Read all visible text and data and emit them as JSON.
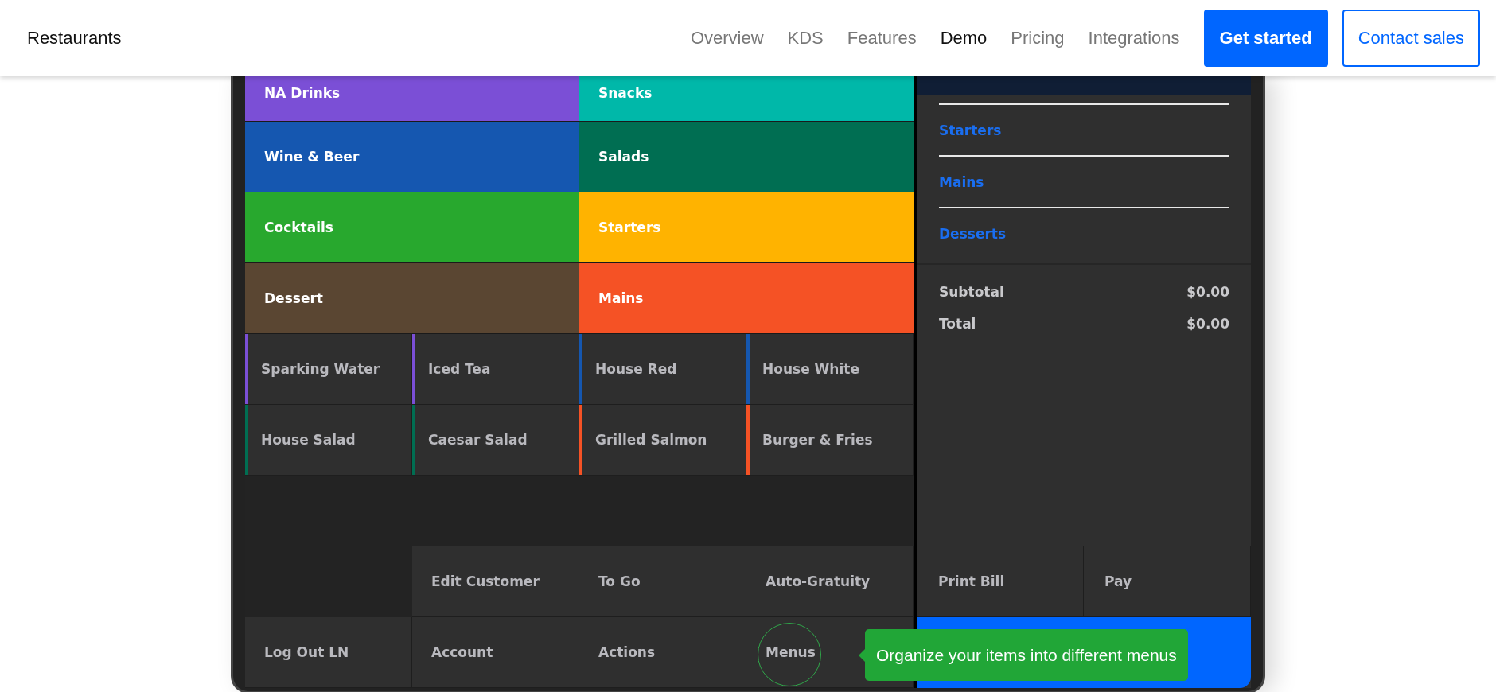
{
  "header": {
    "brand": "Restaurants",
    "nav": [
      {
        "label": "Overview",
        "selected": false
      },
      {
        "label": "KDS",
        "selected": false
      },
      {
        "label": "Features",
        "selected": false
      },
      {
        "label": "Demo",
        "selected": true
      },
      {
        "label": "Pricing",
        "selected": false
      },
      {
        "label": "Integrations",
        "selected": false
      }
    ],
    "buttons": [
      {
        "label": "Get started",
        "kind": "primary"
      },
      {
        "label": "Contact sales",
        "kind": "outline"
      }
    ]
  },
  "categories": [
    {
      "label": "NA Drinks",
      "color": "#7b4fd6"
    },
    {
      "label": "Snacks",
      "color": "#00b8a9"
    },
    {
      "label": "Wine & Beer",
      "color": "#1557b0"
    },
    {
      "label": "Salads",
      "color": "#006e52"
    },
    {
      "label": "Cocktails",
      "color": "#28a82e"
    },
    {
      "label": "Starters",
      "color": "#ffb300"
    },
    {
      "label": "Dessert",
      "color": "#5a4632"
    },
    {
      "label": "Mains",
      "color": "#f55225"
    }
  ],
  "items": [
    {
      "label": "Sparking Water",
      "color": "#7b4fd6"
    },
    {
      "label": "Iced Tea",
      "color": "#7b4fd6"
    },
    {
      "label": "House Red",
      "color": "#1557b0"
    },
    {
      "label": "House White",
      "color": "#1557b0"
    },
    {
      "label": "House Salad",
      "color": "#006e52"
    },
    {
      "label": "Caesar Salad",
      "color": "#006e52"
    },
    {
      "label": "Grilled Salmon",
      "color": "#f55225"
    },
    {
      "label": "Burger & Fries",
      "color": "#f55225"
    }
  ],
  "actions": [
    {
      "kind": "button",
      "label": "Edit Customer",
      "highlighted": false
    },
    {
      "kind": "button",
      "label": "To Go",
      "highlighted": false
    },
    {
      "kind": "button",
      "label": "Auto-Gratuity",
      "highlighted": false
    },
    {
      "kind": "button",
      "label": "Log Out LN",
      "highlighted": false
    },
    {
      "kind": "button",
      "label": "Account",
      "highlighted": false
    },
    {
      "kind": "button",
      "label": "Actions",
      "highlighted": false
    },
    {
      "kind": "button",
      "label": "Menus",
      "highlighted": true
    }
  ],
  "order": {
    "sections": [
      "Starters",
      "Mains",
      "Desserts"
    ],
    "totals": [
      {
        "label": "Subtotal",
        "value": "$0.00"
      },
      {
        "label": "Total",
        "value": "$0.00"
      }
    ],
    "buttons": [
      "Print Bill",
      "Pay"
    ]
  },
  "tooltip": {
    "text": "Organize your items into different menus"
  }
}
